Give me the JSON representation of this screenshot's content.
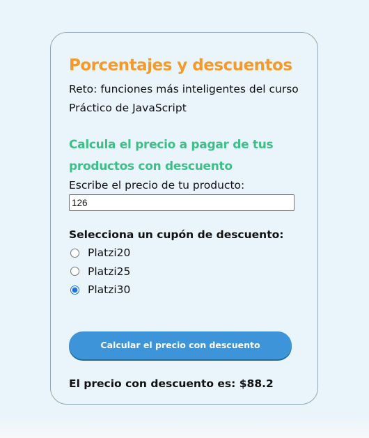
{
  "card": {
    "title": "Porcentajes y descuentos",
    "description": "Reto: funciones más inteligentes del curso Práctico de JavaScript",
    "subtitle": "Calcula el precio a pagar de tus productos con descuento",
    "price_label": "Escribe el precio de tu producto:",
    "price_value": "126",
    "coupon_label": "Selecciona un cupón de descuento:",
    "coupons": [
      {
        "label": "Platzi20",
        "selected": false
      },
      {
        "label": "Platzi25",
        "selected": false
      },
      {
        "label": "Platzi30",
        "selected": true
      }
    ],
    "button_label": "Calcular el precio con descuento",
    "result_text": "El precio con descuento es: $88.2"
  },
  "colors": {
    "background": "#eaf4fb",
    "title": "#f39a2c",
    "subtitle": "#3fbf88",
    "button": "#3d94d9"
  }
}
